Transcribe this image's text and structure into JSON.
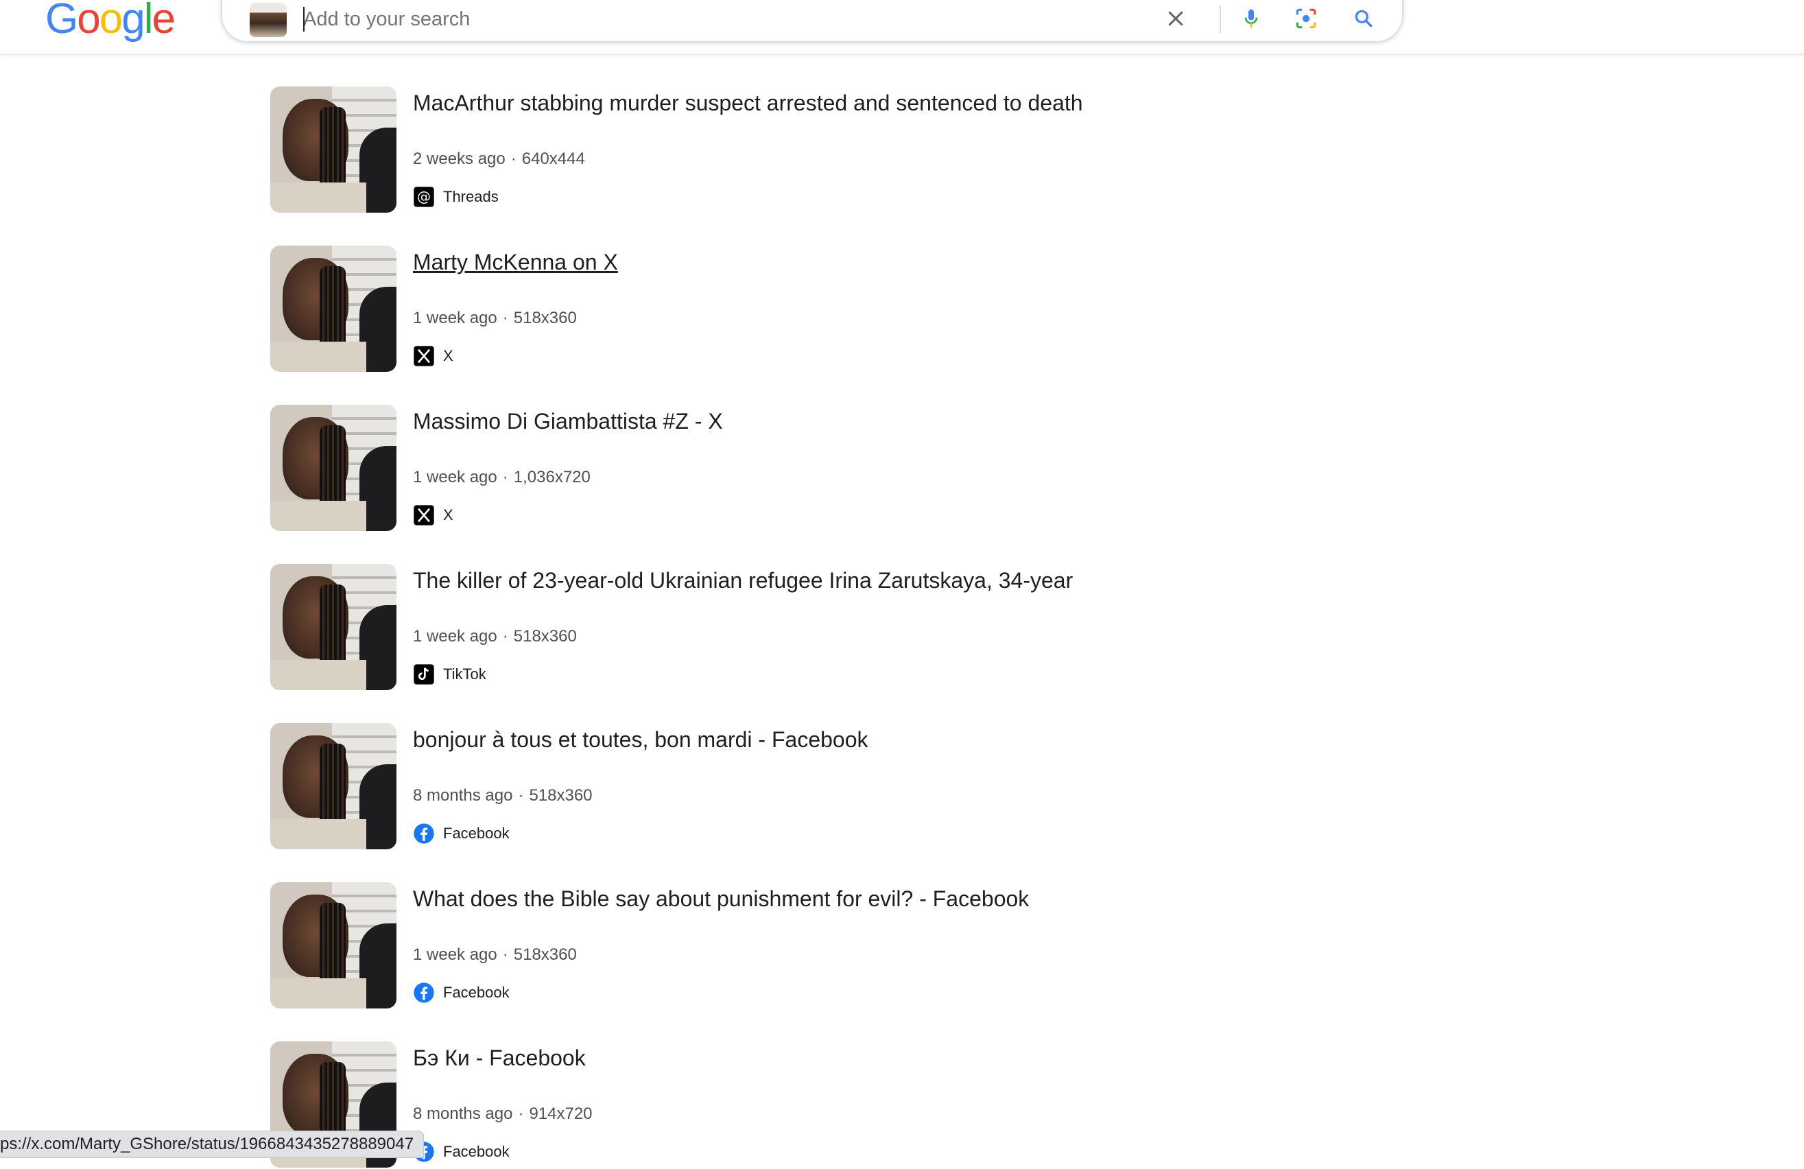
{
  "header": {
    "logo_letters": [
      "G",
      "o",
      "o",
      "g",
      "l",
      "e"
    ],
    "search": {
      "placeholder": "Add to your search",
      "value": ""
    },
    "icons": [
      "close-icon",
      "microphone-icon",
      "lens-icon",
      "search-icon"
    ]
  },
  "results": [
    {
      "title": "MacArthur stabbing murder suspect arrested and sentenced to death",
      "age": "2 weeks ago",
      "size": "640x444",
      "source": "Threads",
      "source_icon": "threads-icon",
      "underlined": false
    },
    {
      "title": "Marty McKenna on X",
      "age": "1 week ago",
      "size": "518x360",
      "source": "X",
      "source_icon": "x-icon",
      "underlined": true
    },
    {
      "title": "Massimo Di Giambattista #Z - X",
      "age": "1 week ago",
      "size": "1,036x720",
      "source": "X",
      "source_icon": "x-icon",
      "underlined": false
    },
    {
      "title": "The killer of 23-year-old Ukrainian refugee Irina Zarutskaya, 34-year",
      "age": "1 week ago",
      "size": "518x360",
      "source": "TikTok",
      "source_icon": "tiktok-icon",
      "underlined": false
    },
    {
      "title": "bonjour à tous et toutes, bon mardi - Facebook",
      "age": "8 months ago",
      "size": "518x360",
      "source": "Facebook",
      "source_icon": "facebook-icon",
      "underlined": false
    },
    {
      "title": "What does the Bible say about punishment for evil? - Facebook",
      "age": "1 week ago",
      "size": "518x360",
      "source": "Facebook",
      "source_icon": "facebook-icon",
      "underlined": false
    },
    {
      "title": "Бэ Ки - Facebook",
      "age": "8 months ago",
      "size": "914x720",
      "source": "Facebook",
      "source_icon": "facebook-icon",
      "underlined": false
    }
  ],
  "status_bar": {
    "url": "ps://x.com/Marty_GShore/status/1966843435278889047"
  },
  "colors": {
    "google_blue": "#4285F4",
    "facebook_blue": "#1877F2"
  }
}
